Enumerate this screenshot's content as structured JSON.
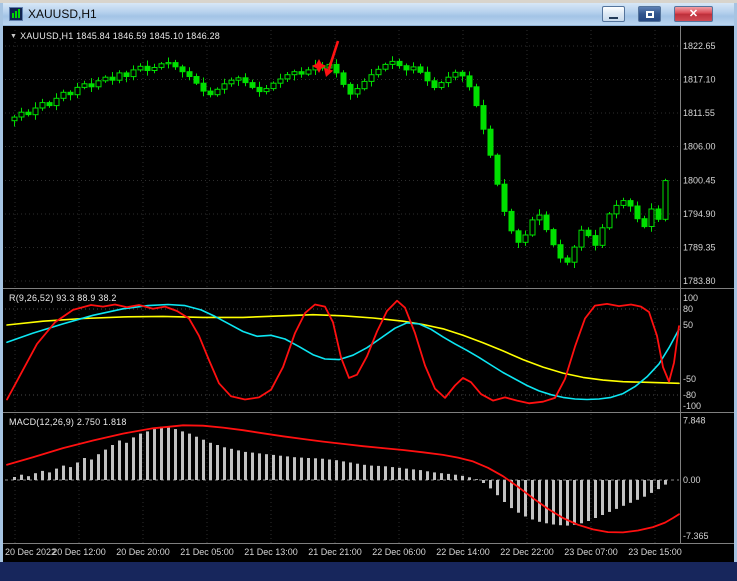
{
  "window": {
    "title": "XAUUSD,H1",
    "icons": {
      "app": "chart-window-icon",
      "minimize": "minimize-icon",
      "restore": "restore-icon",
      "close": "close-icon",
      "close_glyph": "✕"
    }
  },
  "colors": {
    "chart_bg": "#000000",
    "candle": "#00DF00",
    "grid": "#2E2E2E",
    "level": "#4A4A4A",
    "zero_line": "#8C8C8C",
    "separator": "#7F7F7F",
    "axis_text": "#D6D6D6",
    "red": "#FF1010",
    "cyan": "#0CE6F2",
    "yellow": "#FFFF00",
    "macd_hist": "#C2C2C2",
    "macd_signal": "#FF1010"
  },
  "chart_data": {
    "type": "candlestick",
    "symbol": "XAUUSD",
    "timeframe": "H1",
    "header_marker": "▼",
    "header_text": "XAUUSD,H1 1845.84 1846.59 1845.10 1846.28",
    "header_ohlc": {
      "open": 1845.84,
      "high": 1846.59,
      "low": 1845.1,
      "close": 1846.28
    },
    "price_axis_labels": [
      "1822.65",
      "1817.10",
      "1811.55",
      "1806.00",
      "1800.45",
      "1794.90",
      "1789.35",
      "1783.80"
    ],
    "time_axis_labels": [
      "20 Dec 2022",
      "20 Dec 12:00",
      "20 Dec 20:00",
      "21 Dec 05:00",
      "21 Dec 13:00",
      "21 Dec 21:00",
      "22 Dec 06:00",
      "22 Dec 14:00",
      "22 Dec 22:00",
      "23 Dec 07:00",
      "23 Dec 15:00"
    ],
    "candles": {
      "note": "H1 closes left-to-right; open = previous close; wick sizes cycle wick_pattern",
      "wick_pattern": [
        0.35,
        0.75,
        0.5,
        0.95,
        0.6,
        0.3,
        0.85,
        0.45
      ],
      "closes": [
        1810.9,
        1811.7,
        1811.3,
        1812.4,
        1813.3,
        1812.8,
        1814.0,
        1815.0,
        1814.6,
        1815.8,
        1816.4,
        1815.9,
        1816.9,
        1817.5,
        1817.0,
        1818.2,
        1817.6,
        1818.7,
        1819.3,
        1818.6,
        1819.1,
        1819.7,
        1819.9,
        1819.2,
        1818.4,
        1817.6,
        1816.5,
        1815.2,
        1814.6,
        1815.5,
        1816.4,
        1817.0,
        1817.4,
        1816.6,
        1815.8,
        1815.1,
        1815.6,
        1816.5,
        1817.2,
        1817.9,
        1818.4,
        1818.0,
        1818.7,
        1819.4,
        1819.0,
        1819.6,
        1818.2,
        1816.3,
        1814.7,
        1815.6,
        1816.8,
        1817.9,
        1818.8,
        1819.6,
        1820.1,
        1819.4,
        1818.7,
        1819.2,
        1818.3,
        1816.9,
        1815.8,
        1816.6,
        1817.5,
        1818.3,
        1817.7,
        1815.9,
        1812.8,
        1808.9,
        1804.6,
        1799.8,
        1795.3,
        1792.1,
        1790.2,
        1791.4,
        1793.9,
        1794.7,
        1792.3,
        1789.8,
        1787.6,
        1786.9,
        1789.4,
        1792.2,
        1791.3,
        1789.7,
        1792.6,
        1794.9,
        1796.3,
        1797.1,
        1796.2,
        1794.1,
        1792.8,
        1795.7,
        1794.0,
        1800.4
      ]
    },
    "oscillator_pane": {
      "label": "R(9,26,52) 93.3 88.9 38.2",
      "scale_labels": [
        "100",
        "80",
        "50",
        "-50",
        "-80",
        "-100"
      ],
      "level_lines": [
        80,
        -80
      ],
      "series": {
        "fast_red": [
          [
            4,
            -88
          ],
          [
            18,
            -40
          ],
          [
            34,
            15
          ],
          [
            52,
            55
          ],
          [
            70,
            78
          ],
          [
            88,
            87
          ],
          [
            100,
            84
          ],
          [
            112,
            88
          ],
          [
            124,
            83
          ],
          [
            136,
            87
          ],
          [
            150,
            80
          ],
          [
            162,
            84
          ],
          [
            174,
            76
          ],
          [
            186,
            62
          ],
          [
            196,
            30
          ],
          [
            206,
            -15
          ],
          [
            216,
            -58
          ],
          [
            228,
            -82
          ],
          [
            242,
            -88
          ],
          [
            256,
            -84
          ],
          [
            268,
            -70
          ],
          [
            280,
            -28
          ],
          [
            292,
            35
          ],
          [
            302,
            72
          ],
          [
            312,
            88
          ],
          [
            322,
            84
          ],
          [
            330,
            55
          ],
          [
            338,
            -10
          ],
          [
            346,
            -48
          ],
          [
            354,
            -42
          ],
          [
            364,
            -8
          ],
          [
            374,
            38
          ],
          [
            384,
            76
          ],
          [
            394,
            95
          ],
          [
            402,
            82
          ],
          [
            412,
            35
          ],
          [
            422,
            -25
          ],
          [
            432,
            -68
          ],
          [
            442,
            -85
          ],
          [
            452,
            -62
          ],
          [
            460,
            -48
          ],
          [
            468,
            -56
          ],
          [
            478,
            -78
          ],
          [
            490,
            -90
          ],
          [
            502,
            -84
          ],
          [
            514,
            -90
          ],
          [
            526,
            -95
          ],
          [
            540,
            -92
          ],
          [
            552,
            -85
          ],
          [
            562,
            -50
          ],
          [
            572,
            10
          ],
          [
            582,
            62
          ],
          [
            592,
            86
          ],
          [
            604,
            89
          ],
          [
            616,
            85
          ],
          [
            628,
            88
          ],
          [
            638,
            84
          ],
          [
            646,
            74
          ],
          [
            654,
            30
          ],
          [
            660,
            -28
          ],
          [
            666,
            -55
          ],
          [
            671,
            -20
          ],
          [
            676,
            48
          ]
        ],
        "mid_cyan": [
          [
            4,
            18
          ],
          [
            30,
            35
          ],
          [
            60,
            52
          ],
          [
            90,
            68
          ],
          [
            120,
            80
          ],
          [
            145,
            86
          ],
          [
            165,
            88
          ],
          [
            182,
            86
          ],
          [
            198,
            78
          ],
          [
            212,
            66
          ],
          [
            226,
            52
          ],
          [
            240,
            38
          ],
          [
            254,
            29
          ],
          [
            268,
            31
          ],
          [
            282,
            24
          ],
          [
            296,
            10
          ],
          [
            310,
            -5
          ],
          [
            322,
            -13
          ],
          [
            336,
            -14
          ],
          [
            350,
            -6
          ],
          [
            364,
            8
          ],
          [
            378,
            26
          ],
          [
            392,
            44
          ],
          [
            404,
            54
          ],
          [
            416,
            52
          ],
          [
            428,
            42
          ],
          [
            440,
            28
          ],
          [
            452,
            15
          ],
          [
            464,
            3
          ],
          [
            476,
            -10
          ],
          [
            488,
            -24
          ],
          [
            500,
            -38
          ],
          [
            512,
            -50
          ],
          [
            524,
            -62
          ],
          [
            536,
            -72
          ],
          [
            548,
            -79
          ],
          [
            560,
            -84
          ],
          [
            572,
            -87
          ],
          [
            584,
            -88
          ],
          [
            596,
            -87
          ],
          [
            608,
            -84
          ],
          [
            620,
            -77
          ],
          [
            632,
            -64
          ],
          [
            644,
            -46
          ],
          [
            656,
            -22
          ],
          [
            666,
            8
          ],
          [
            676,
            42
          ]
        ],
        "slow_yellow": [
          [
            4,
            50
          ],
          [
            40,
            57
          ],
          [
            80,
            62
          ],
          [
            120,
            65
          ],
          [
            160,
            66
          ],
          [
            200,
            64
          ],
          [
            240,
            64
          ],
          [
            280,
            67
          ],
          [
            310,
            69
          ],
          [
            340,
            67
          ],
          [
            370,
            63
          ],
          [
            400,
            57
          ],
          [
            420,
            51
          ],
          [
            440,
            43
          ],
          [
            460,
            31
          ],
          [
            480,
            17
          ],
          [
            500,
            2
          ],
          [
            520,
            -14
          ],
          [
            540,
            -28
          ],
          [
            560,
            -39
          ],
          [
            580,
            -47
          ],
          [
            600,
            -52
          ],
          [
            620,
            -55
          ],
          [
            640,
            -56
          ],
          [
            660,
            -57
          ],
          [
            676,
            -58
          ]
        ]
      }
    },
    "macd_pane": {
      "label": "MACD(12,26,9) 2.750 1.818",
      "scale_labels": [
        "7.848",
        "0.00",
        "-7.365"
      ],
      "histogram": [
        0.4,
        0.7,
        0.5,
        0.9,
        1.2,
        1.0,
        1.5,
        1.9,
        1.7,
        2.3,
        2.9,
        2.7,
        3.4,
        4.0,
        4.6,
        5.2,
        4.9,
        5.6,
        6.1,
        6.4,
        6.7,
        7.0,
        6.9,
        6.7,
        6.4,
        6.1,
        5.7,
        5.3,
        4.9,
        4.6,
        4.3,
        4.1,
        3.9,
        3.7,
        3.6,
        3.5,
        3.4,
        3.3,
        3.2,
        3.1,
        3.0,
        2.95,
        2.9,
        2.85,
        2.8,
        2.7,
        2.6,
        2.45,
        2.3,
        2.15,
        2.0,
        1.9,
        1.85,
        1.8,
        1.7,
        1.6,
        1.5,
        1.4,
        1.3,
        1.15,
        1.0,
        0.9,
        0.8,
        0.7,
        0.55,
        0.35,
        0.1,
        -0.4,
        -1.1,
        -2.0,
        -2.9,
        -3.7,
        -4.3,
        -4.8,
        -5.2,
        -5.5,
        -5.7,
        -5.85,
        -5.95,
        -6.0,
        -5.9,
        -5.7,
        -5.4,
        -5.0,
        -4.6,
        -4.2,
        -3.8,
        -3.4,
        -3.0,
        -2.6,
        -2.2,
        -1.7,
        -1.2,
        -0.6
      ],
      "signal_red": [
        [
          4,
          2.0
        ],
        [
          30,
          3.0
        ],
        [
          60,
          4.2
        ],
        [
          90,
          5.2
        ],
        [
          120,
          6.1
        ],
        [
          150,
          6.8
        ],
        [
          180,
          7.2
        ],
        [
          200,
          7.15
        ],
        [
          220,
          6.9
        ],
        [
          240,
          6.55
        ],
        [
          260,
          6.15
        ],
        [
          280,
          5.75
        ],
        [
          300,
          5.4
        ],
        [
          320,
          5.05
        ],
        [
          340,
          4.75
        ],
        [
          360,
          4.45
        ],
        [
          380,
          4.2
        ],
        [
          400,
          3.95
        ],
        [
          420,
          3.65
        ],
        [
          440,
          3.3
        ],
        [
          455,
          2.95
        ],
        [
          470,
          2.45
        ],
        [
          485,
          1.6
        ],
        [
          500,
          0.5
        ],
        [
          515,
          -0.9
        ],
        [
          530,
          -2.4
        ],
        [
          545,
          -3.8
        ],
        [
          560,
          -5.0
        ],
        [
          575,
          -5.9
        ],
        [
          590,
          -6.5
        ],
        [
          605,
          -6.85
        ],
        [
          620,
          -6.9
        ],
        [
          635,
          -6.65
        ],
        [
          650,
          -6.2
        ],
        [
          662,
          -5.6
        ],
        [
          670,
          -5.0
        ],
        [
          676,
          -4.5
        ]
      ]
    },
    "annotation": {
      "name": "sell-arrow",
      "color": "#FF1212"
    }
  }
}
